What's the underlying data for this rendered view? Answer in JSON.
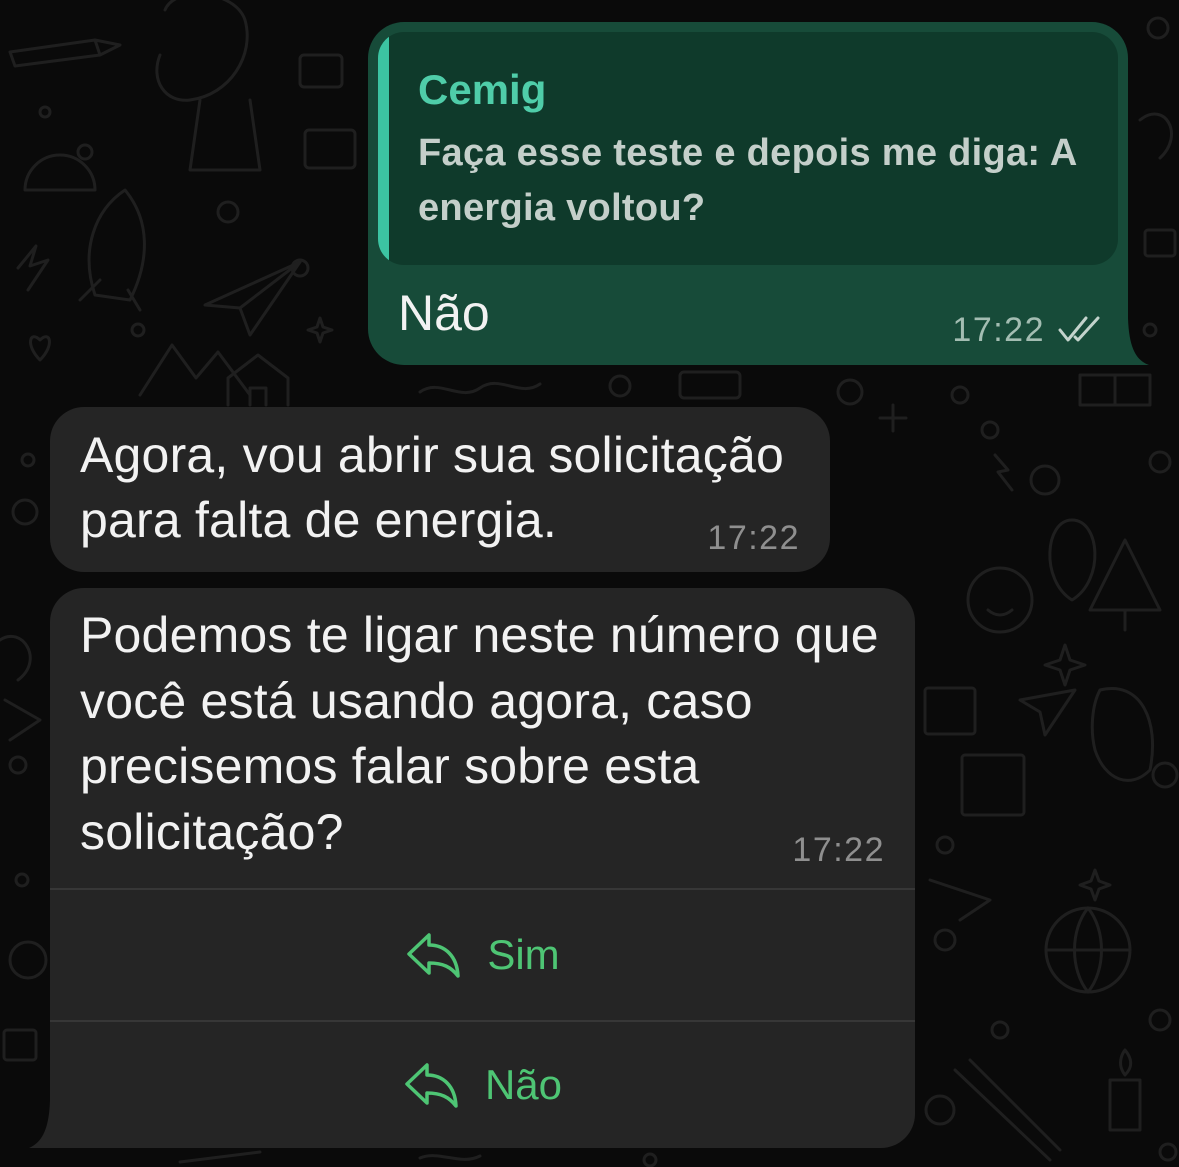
{
  "outgoing_message": {
    "quote": {
      "author": "Cemig",
      "text_lines": [
        "Faça esse teste e depois me diga: A",
        "energia voltou?"
      ]
    },
    "text_lines": [
      "Não"
    ],
    "time": "17:22",
    "status_icon": "double-check-icon"
  },
  "incoming_messages": [
    {
      "text_lines": [
        "Agora, vou abrir sua solicitação",
        "para falta de energia."
      ],
      "time": "17:22"
    },
    {
      "text_lines": [
        "Podemos te ligar neste número que",
        "você está usando agora, caso",
        "precisemos falar sobre esta",
        "solicitação?"
      ],
      "time": "17:22",
      "quick_replies": [
        {
          "label": "Sim",
          "icon": "reply-icon"
        },
        {
          "label": "Não",
          "icon": "reply-icon"
        }
      ]
    }
  ],
  "colors": {
    "background": "#0a0a0a",
    "wallpaper_doodle": "#1f1f1f",
    "outgoing_bubble": "#174b39",
    "quote_background": "#0f3a2b",
    "quote_accent": "#3cc4a2",
    "quote_author": "#4fcda9",
    "quote_text": "#c4cfca",
    "message_text": "#f2f2f2",
    "outgoing_time": "#a3bdb2",
    "read_receipt": "#c3d3cc",
    "incoming_bubble": "#252525",
    "incoming_time": "#8f8f8f",
    "divider": "#373737",
    "quick_reply": "#4ec574"
  }
}
